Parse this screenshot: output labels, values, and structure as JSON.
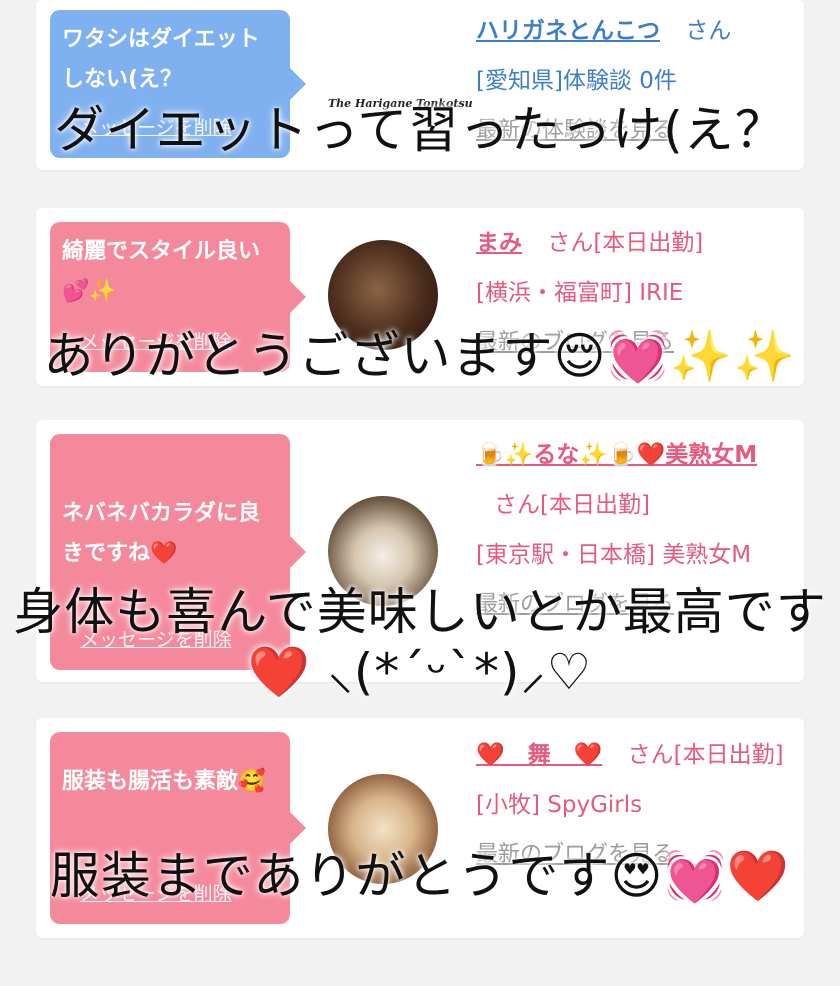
{
  "cards": [
    {
      "bubble_color": "#7fb0ef",
      "message": "ワタシはダイエットしない(え？",
      "delete_label": "メッセージを削除",
      "name": "ハリガネとんこつ",
      "san": "さん",
      "details": "[愛知県]体験談 0件",
      "latest": "最新の体験談を見る",
      "brand": "The Harigane Tonkotsu"
    },
    {
      "bubble_color": "#f5899c",
      "message": "綺麗でスタイル良い💕✨",
      "delete_label": "メッセージを削除",
      "name": "まみ",
      "san": "さん[本日出勤]",
      "details": "[横浜・福富町] IRIE",
      "latest": "最新のブログを見る"
    },
    {
      "bubble_color": "#f5899c",
      "message": "ネバネバカラダに良きですね❤️",
      "delete_label": "メッセージを削除",
      "name": "🍺✨るな✨🍺❤️美熟女M",
      "san": "さん[本日出勤]",
      "details": "[東京駅・日本橋] 美熟女M",
      "latest": "最新のブログを見る"
    },
    {
      "bubble_color": "#f5899c",
      "message": "服装も腸活も素敵🥰",
      "delete_label": "メッセージを削除",
      "name": "❤️　舞　❤️",
      "san": "さん[本日出勤]",
      "details": "[小牧] SpyGirls",
      "latest": "最新のブログを見る"
    }
  ],
  "overlays": {
    "line1": "ダイエットって習ったっけ(え？",
    "line2": "ありがとうございます😌💓✨✨",
    "line3": "身体も喜んで美味しいとか最高です❤️ ⸜(*ˊᵕˋ*)⸝♡",
    "line4": "服装までありがとうです😍💓❤️"
  }
}
